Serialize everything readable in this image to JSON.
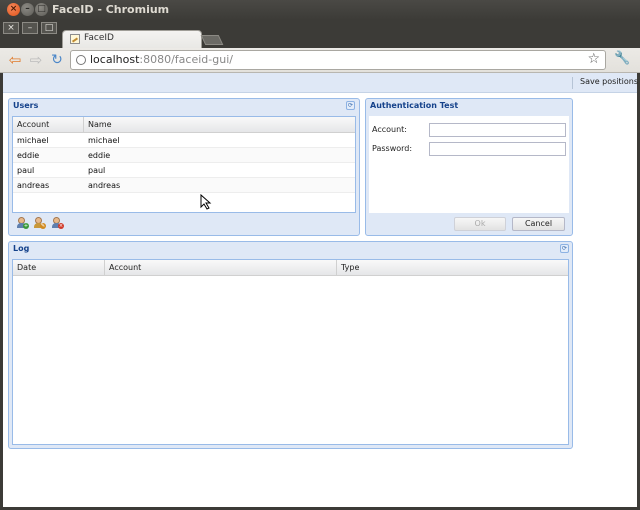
{
  "window": {
    "title": "FaceID - Chromium",
    "close_glyph": "×",
    "minimize_glyph": "–",
    "maximize_glyph": "□"
  },
  "browser": {
    "menu_close": "×",
    "menu_min": "–",
    "menu_max": "□",
    "tab_title": "FaceID",
    "url_host": "localhost",
    "url_path": ":8080/faceid-gui/",
    "back_glyph": "⇦",
    "forward_glyph": "⇨",
    "reload_glyph": "↻",
    "star_glyph": "☆",
    "wrench_glyph": "🔧"
  },
  "topbar": {
    "save_positions": "Save positions"
  },
  "users": {
    "title": "Users",
    "columns": [
      "Account",
      "Name"
    ],
    "rows": [
      {
        "account": "michael",
        "name": "michael"
      },
      {
        "account": "eddie",
        "name": "eddie"
      },
      {
        "account": "paul",
        "name": "paul"
      },
      {
        "account": "andreas",
        "name": "andreas"
      }
    ],
    "toolbar_icons": [
      "user-add-icon",
      "user-edit-icon",
      "user-delete-icon"
    ]
  },
  "auth": {
    "title": "Authentication Test",
    "account_label": "Account:",
    "password_label": "Password:",
    "account_value": "",
    "password_value": "",
    "ok_label": "Ok",
    "cancel_label": "Cancel"
  },
  "log": {
    "title": "Log",
    "columns": [
      "Date",
      "Account",
      "Type"
    ]
  },
  "colors": {
    "panel_bg": "#dfe8f6",
    "panel_border": "#99bbe8",
    "panel_title": "#15428b"
  }
}
